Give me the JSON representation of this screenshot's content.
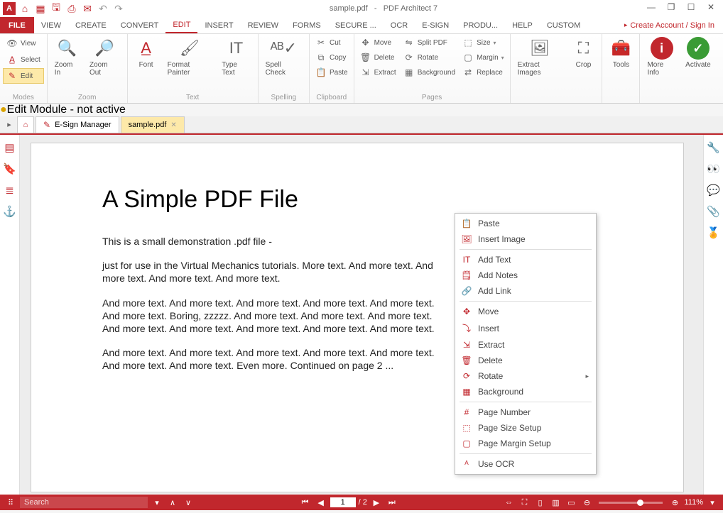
{
  "title": {
    "filename": "sample.pdf",
    "sep": "-",
    "app": "PDF Architect 7"
  },
  "menu": {
    "file": "FILE",
    "tabs": [
      "VIEW",
      "CREATE",
      "CONVERT",
      "EDIT",
      "INSERT",
      "REVIEW",
      "FORMS",
      "SECURE ...",
      "OCR",
      "E-SIGN",
      "PRODU...",
      "HELP",
      "CUSTOM"
    ],
    "active": "EDIT",
    "account": "Create Account / Sign In"
  },
  "ribbon": {
    "modes": {
      "view": "View",
      "select": "Select",
      "edit": "Edit",
      "label": "Modes"
    },
    "zoom": {
      "in": "Zoom In",
      "out": "Zoom Out",
      "label": "Zoom"
    },
    "text": {
      "font": "Font",
      "painter": "Format Painter",
      "type": "Type Text",
      "label": "Text"
    },
    "spell": {
      "check": "Spell Check",
      "label": "Spelling"
    },
    "clip": {
      "cut": "Cut",
      "copy": "Copy",
      "paste": "Paste",
      "label": "Clipboard"
    },
    "pages": {
      "move": "Move",
      "delete": "Delete",
      "extract": "Extract",
      "split": "Split PDF",
      "rotate": "Rotate",
      "background": "Background",
      "size": "Size",
      "margin": "Margin",
      "replace": "Replace",
      "label": "Pages"
    },
    "extract": {
      "images": "Extract Images"
    },
    "crop": "Crop",
    "tools": "Tools",
    "moreinfo": "More Info",
    "activate": "Activate",
    "editmodule": "Edit Module - not active"
  },
  "doctabs": {
    "esign": "E-Sign Manager",
    "sample": "sample.pdf"
  },
  "doc": {
    "h1": "A Simple PDF File",
    "p1": "This is a small demonstration .pdf file -",
    "p2": "just for use in the Virtual Mechanics tutorials. More text. And more text. And more text. And more text. And more text.",
    "p3": "And more text. And more text. And more text. And more text. And more text. And more text. Boring, zzzzz. And more text. And more text. And more text. And more text. And more text. And more text. And more text. And more text.",
    "p4": "And more text. And more text. And more text. And more text. And more text. And more text. And more text. Even more. Continued on page 2 ..."
  },
  "ctx": {
    "paste": "Paste",
    "insertimg": "Insert Image",
    "addtext": "Add Text",
    "addnotes": "Add Notes",
    "addlink": "Add Link",
    "move": "Move",
    "insert": "Insert",
    "extract": "Extract",
    "delete": "Delete",
    "rotate": "Rotate",
    "background": "Background",
    "pagenum": "Page Number",
    "pagesize": "Page Size Setup",
    "pagemargin": "Page Margin Setup",
    "ocr": "Use OCR"
  },
  "status": {
    "search": "Search",
    "page": "1",
    "total": "/ 2",
    "zoom": "111%"
  }
}
